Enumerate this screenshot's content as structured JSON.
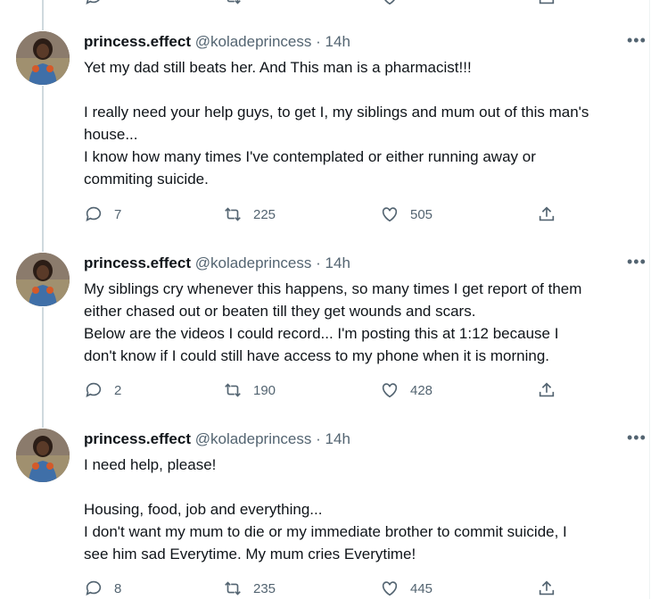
{
  "tweets": [
    {
      "name": "princess.effect",
      "handle": "@koladeprincess",
      "separator": "·",
      "time": "14h",
      "lines": [
        "Yet my dad still beats her. And This man is a pharmacist!!!",
        "",
        "I really need your help guys, to get I, my siblings and mum out of this man's",
        "house...",
        "I know how many times I've contemplated or either running away or",
        "commiting suicide."
      ],
      "replies": "7",
      "retweets": "225",
      "likes": "505"
    },
    {
      "name": "princess.effect",
      "handle": "@koladeprincess",
      "separator": "·",
      "time": "14h",
      "lines": [
        "My siblings cry whenever this happens, so many times I get report of them",
        "either chased out or beaten till they get wounds and scars.",
        "Below are the videos I could record... I'm posting this at 1:12 because I",
        "don't know if I could still have access to my phone when it is morning."
      ],
      "replies": "2",
      "retweets": "190",
      "likes": "428"
    },
    {
      "name": "princess.effect",
      "handle": "@koladeprincess",
      "separator": "·",
      "time": "14h",
      "lines": [
        "I need help, please!",
        "",
        "Housing, food, job and everything...",
        "I don't want my mum to die or my immediate brother to commit suicide, I",
        "see him sad Everytime. My mum cries Everytime!"
      ],
      "replies": "8",
      "retweets": "235",
      "likes": "445"
    }
  ],
  "icons": {
    "reply": "reply-icon",
    "retweet": "retweet-icon",
    "like": "like-icon",
    "share": "share-icon",
    "more": "more-icon"
  },
  "colors": {
    "text": "#0f1419",
    "secondary": "#536471",
    "thread_line": "#cfd9de"
  }
}
